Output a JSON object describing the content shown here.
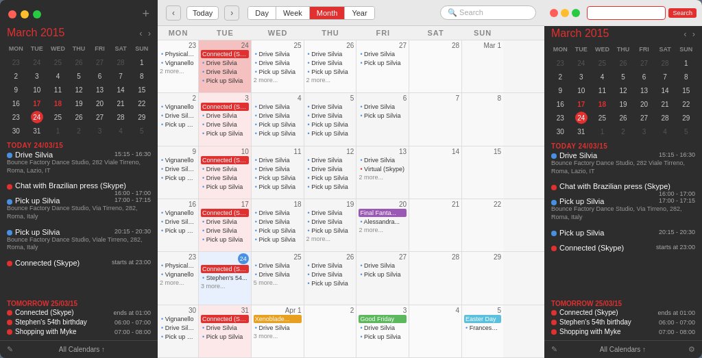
{
  "app": {
    "title": "Calendar"
  },
  "left_panel": {
    "month_title": "March",
    "month_year": "2015",
    "nav_prev": "‹",
    "nav_next": "›",
    "mini_cal": {
      "headers": [
        "MON",
        "TUE",
        "WED",
        "THU",
        "FRI",
        "SAT",
        "SUN"
      ],
      "weeks": [
        [
          {
            "num": "23",
            "type": "other"
          },
          {
            "num": "24",
            "type": "other"
          },
          {
            "num": "25",
            "type": "other"
          },
          {
            "num": "26",
            "type": "other"
          },
          {
            "num": "27",
            "type": "other"
          },
          {
            "num": "28",
            "type": "other"
          },
          {
            "num": "1",
            "type": "normal"
          }
        ],
        [
          {
            "num": "2",
            "type": "normal"
          },
          {
            "num": "3",
            "type": "normal"
          },
          {
            "num": "4",
            "type": "normal"
          },
          {
            "num": "5",
            "type": "normal"
          },
          {
            "num": "6",
            "type": "normal"
          },
          {
            "num": "7",
            "type": "normal"
          },
          {
            "num": "8",
            "type": "normal"
          }
        ],
        [
          {
            "num": "9",
            "type": "normal"
          },
          {
            "num": "10",
            "type": "normal"
          },
          {
            "num": "11",
            "type": "normal"
          },
          {
            "num": "12",
            "type": "normal"
          },
          {
            "num": "13",
            "type": "normal"
          },
          {
            "num": "14",
            "type": "normal"
          },
          {
            "num": "15",
            "type": "normal"
          }
        ],
        [
          {
            "num": "16",
            "type": "normal"
          },
          {
            "num": "17",
            "type": "normal"
          },
          {
            "num": "18",
            "type": "normal"
          },
          {
            "num": "19",
            "type": "normal"
          },
          {
            "num": "20",
            "type": "normal"
          },
          {
            "num": "21",
            "type": "normal"
          },
          {
            "num": "22",
            "type": "normal"
          }
        ],
        [
          {
            "num": "23",
            "type": "normal"
          },
          {
            "num": "24",
            "type": "today"
          },
          {
            "num": "25",
            "type": "normal"
          },
          {
            "num": "26",
            "type": "normal"
          },
          {
            "num": "27",
            "type": "normal"
          },
          {
            "num": "28",
            "type": "normal"
          },
          {
            "num": "29",
            "type": "normal"
          }
        ],
        [
          {
            "num": "30",
            "type": "normal"
          },
          {
            "num": "31",
            "type": "normal"
          },
          {
            "num": "1",
            "type": "other"
          },
          {
            "num": "2",
            "type": "other"
          },
          {
            "num": "3",
            "type": "other"
          },
          {
            "num": "4",
            "type": "other"
          },
          {
            "num": "5",
            "type": "other"
          }
        ]
      ]
    },
    "today_label": "TODAY 24/03/15",
    "events_today": [
      {
        "name": "Drive Silvia",
        "time": "15:15 - 16:30",
        "detail": "Bounce Factory Dance Studio, 282 Viale Tirreno, Roma, Lazio, IT",
        "dot": "blue"
      },
      {
        "name": "Chat with Brazilian press (Skype)",
        "time": "16:00 - 17:00",
        "detail": "",
        "dot": "red"
      },
      {
        "name": "Pick up Silvia",
        "time": "17:00 - 17:15",
        "detail": "Bounce Factory Dance Studio, Via Tirreno, 282, Roma, Italy",
        "dot": "blue"
      },
      {
        "name": "Pick up Silvia",
        "time": "20:15 - 20:30",
        "detail": "Bounce Factory Dance Studio, Viale Tirreno, 282, Roma, Italy",
        "dot": "blue"
      },
      {
        "name": "Connected (Skype)",
        "time": "starts at 23:00",
        "detail": "",
        "dot": "red"
      }
    ],
    "tomorrow_label": "TOMORROW 25/03/15",
    "events_tomorrow": [
      {
        "name": "Connected (Skype)",
        "time": "ends at 01:00",
        "dot": "red"
      },
      {
        "name": "Stephen's 54th birthday",
        "time": "06:00 - 07:00",
        "dot": "red"
      },
      {
        "name": "Shopping with Myke",
        "time": "07:00 - 08:00",
        "dot": "red"
      }
    ],
    "bottom_label": "All Calendars ↑"
  },
  "toolbar": {
    "nav_prev": "‹",
    "nav_next": "›",
    "today": "Today",
    "views": [
      "Day",
      "Week",
      "Month",
      "Year"
    ],
    "active_view": "Month",
    "search_placeholder": "Search"
  },
  "calendar": {
    "headers": [
      "MON",
      "TUE",
      "WED",
      "THU",
      "FRI",
      "SAT",
      "SUN"
    ],
    "weeks": [
      {
        "cells": [
          {
            "day": "23",
            "type": "other",
            "events": [
              "Physical ther...",
              "Vignanello",
              "• 2 more..."
            ]
          },
          {
            "day": "24",
            "type": "other",
            "events": [
              "Connected (Skype)",
              "Drive Silvia",
              "Drive Silvia",
              "Pick up Silvia"
            ]
          },
          {
            "day": "25",
            "type": "other",
            "events": [
              "Drive Silvia",
              "Drive Silvia",
              "Pick up Silvia",
              "• 2 more..."
            ]
          },
          {
            "day": "26",
            "type": "other",
            "events": [
              "Drive Silvia",
              "Drive Silvia",
              "Pick up Silvia",
              "• 2 more..."
            ]
          },
          {
            "day": "27",
            "type": "other",
            "events": [
              "Drive Silvia",
              "Pick up Silvia"
            ]
          },
          {
            "day": "28",
            "type": "weekend-other",
            "events": []
          },
          {
            "day": "Mar 1",
            "type": "weekend-other",
            "events": []
          }
        ]
      },
      {
        "cells": [
          {
            "day": "2",
            "type": "normal",
            "events": [
              "Vignanello",
              "Drive Silvia",
              "Pick up Silvia"
            ]
          },
          {
            "day": "3",
            "type": "normal",
            "events": [
              "Connected (Skype)",
              "Drive Silvia",
              "Drive Silvia",
              "Pick up Silvia"
            ]
          },
          {
            "day": "4",
            "type": "normal",
            "events": [
              "Drive Silvia",
              "Drive Silvia",
              "Pick up Silvia",
              "Pick up Silvia"
            ]
          },
          {
            "day": "5",
            "type": "normal",
            "events": [
              "Drive Silvia",
              "Drive Silvia",
              "Pick up Silvia",
              "Pick up Silvia"
            ]
          },
          {
            "day": "6",
            "type": "normal",
            "events": [
              "Drive Silvia",
              "Pick up Silvia"
            ]
          },
          {
            "day": "7",
            "type": "weekend",
            "events": []
          },
          {
            "day": "8",
            "type": "weekend",
            "events": []
          }
        ]
      },
      {
        "cells": [
          {
            "day": "9",
            "type": "normal",
            "events": [
              "Vignanello",
              "Drive Silvia",
              "Pick up Silvia"
            ]
          },
          {
            "day": "10",
            "type": "normal",
            "events": [
              "Connected (Skype)",
              "Drive Silvia",
              "Drive Silvia",
              "Pick up Silvia"
            ]
          },
          {
            "day": "11",
            "type": "normal",
            "events": [
              "Drive Silvia",
              "Drive Silvia",
              "Pick up Silvia",
              "Pick up Silvia"
            ]
          },
          {
            "day": "12",
            "type": "normal",
            "events": [
              "Drive Silvia",
              "Drive Silvia",
              "Pick up Silvia",
              "Pick up Silvia"
            ]
          },
          {
            "day": "13",
            "type": "normal",
            "events": [
              "Drive Silvia",
              "Virtual (Skype)",
              "• 2 more..."
            ]
          },
          {
            "day": "14",
            "type": "weekend",
            "events": []
          },
          {
            "day": "15",
            "type": "weekend",
            "events": []
          }
        ]
      },
      {
        "cells": [
          {
            "day": "16",
            "type": "normal",
            "events": [
              "Vignanello",
              "Drive Silvia",
              "Pick up Silvia"
            ]
          },
          {
            "day": "17",
            "type": "normal",
            "events": [
              "Connected (Skype)",
              "Drive Silvia",
              "Drive Silvia",
              "Pick up Silvia"
            ]
          },
          {
            "day": "18",
            "type": "normal",
            "events": [
              "Drive Silvia",
              "Drive Silvia",
              "Pick up Silvia",
              "Pick up Silvia"
            ]
          },
          {
            "day": "19",
            "type": "normal",
            "events": [
              "Drive Silvia",
              "Drive Silvia",
              "Pick up Silvia",
              "• 2 more..."
            ]
          },
          {
            "day": "20",
            "type": "normal",
            "events": [
              "Final Fanta...",
              "Alessandra...",
              "• 2 more..."
            ]
          },
          {
            "day": "21",
            "type": "weekend",
            "events": []
          },
          {
            "day": "22",
            "type": "weekend",
            "events": []
          }
        ]
      },
      {
        "cells": [
          {
            "day": "23",
            "type": "normal",
            "events": [
              "Physical ther...",
              "Vignanello",
              "• 2 more..."
            ]
          },
          {
            "day": "24",
            "type": "today",
            "events": [
              "Connected (Skype)",
              "Stephen's 54...",
              "• 3 more..."
            ]
          },
          {
            "day": "25",
            "type": "normal",
            "events": [
              "Drive Silvia",
              "Drive Silvia",
              "• 5 more..."
            ]
          },
          {
            "day": "26",
            "type": "normal",
            "events": [
              "Drive Silvia",
              "Drive Silvia",
              "Pick up Silvia"
            ]
          },
          {
            "day": "27",
            "type": "normal",
            "events": [
              "Drive Silvia",
              "Pick up Silvia"
            ]
          },
          {
            "day": "28",
            "type": "weekend",
            "events": []
          },
          {
            "day": "29",
            "type": "weekend",
            "events": []
          }
        ]
      },
      {
        "cells": [
          {
            "day": "30",
            "type": "normal",
            "events": [
              "Vignanello",
              "Drive Silvia",
              "Pick up Silvia"
            ]
          },
          {
            "day": "31",
            "type": "normal",
            "events": [
              "Connected (Skype)",
              "Drive Silvia",
              "Pick up Silvia"
            ]
          },
          {
            "day": "Apr 1",
            "type": "other",
            "events": [
              "Xenoblade...",
              "Drive Silvia",
              "• 3 more..."
            ]
          },
          {
            "day": "2",
            "type": "other",
            "events": []
          },
          {
            "day": "3",
            "type": "other",
            "events": [
              "Good Friday",
              "Drive Silvia",
              "Pick up Silvia"
            ]
          },
          {
            "day": "4",
            "type": "weekend-other",
            "events": []
          },
          {
            "day": "5",
            "type": "weekend-other",
            "events": [
              "Easter Day",
              "Francesca..."
            ]
          }
        ]
      }
    ]
  },
  "right_panel": {
    "month_title": "March",
    "month_year": "2015",
    "today_label": "TODAY 24/03/15",
    "tomorrow_label": "TOMORROW 25/03/15",
    "bottom_label": "All Calendars ↑"
  }
}
